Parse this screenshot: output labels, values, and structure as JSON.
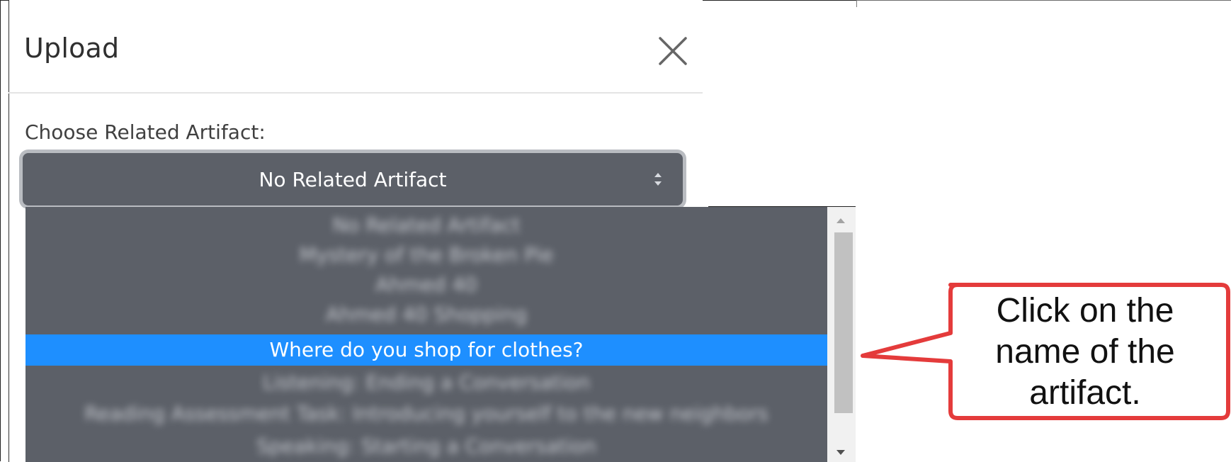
{
  "modal": {
    "title": "Upload",
    "close_icon": "close-icon"
  },
  "form": {
    "label": "Choose Related Artifact:",
    "select": {
      "value": "No Related Artifact",
      "caret_icon": "sort-caret-icon"
    }
  },
  "dropdown": {
    "options": [
      "No Related Artifact",
      "Mystery of the Broken Pie",
      "Ahmed 40",
      "Ahmed 40 Shopping",
      "Where do you shop for clothes?",
      "Listening: Ending a Conversation",
      "Reading Assessment Task: Introducing yourself to the new neighbors",
      "Speaking: Starting a Conversation"
    ],
    "selected_index": 4
  },
  "callout": {
    "text": "Click on the name of the artifact."
  },
  "colors": {
    "select_bg": "#5c6068",
    "highlight": "#1e8fff",
    "callout_border": "#e43b3b"
  }
}
